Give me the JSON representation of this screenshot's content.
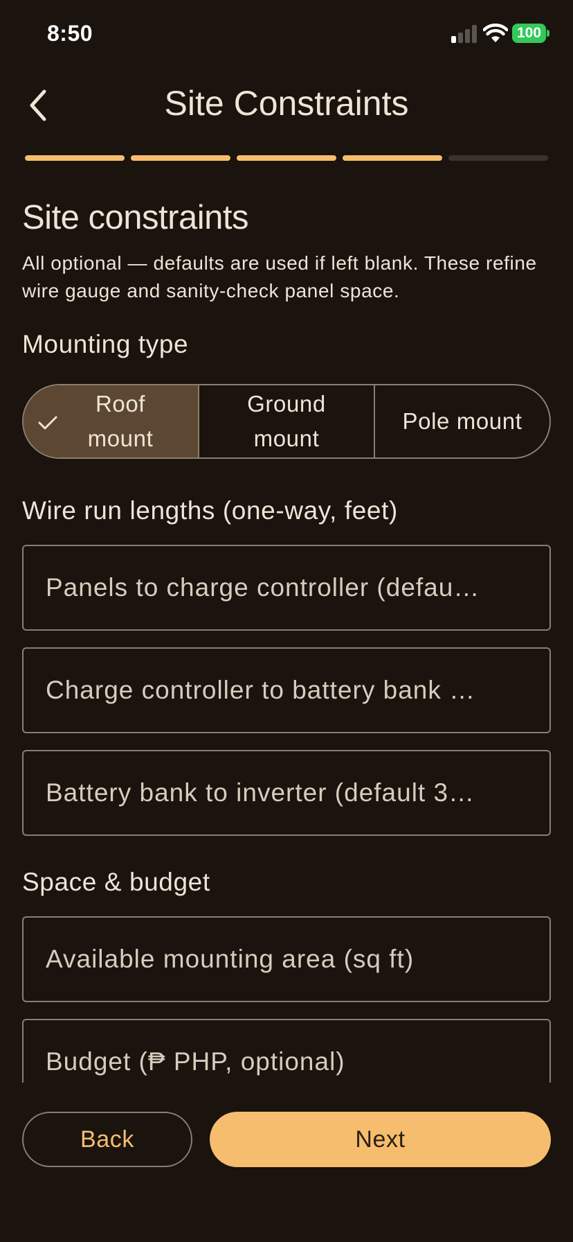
{
  "status_bar": {
    "time": "8:50",
    "battery": "100"
  },
  "header": {
    "title": "Site Constraints",
    "back_icon": "chevron-left-icon"
  },
  "progress": {
    "total_steps": 5,
    "completed_steps": 4
  },
  "intro": {
    "heading": "Site constraints",
    "description": "All optional — defaults are used if left blank. These refine wire gauge and sanity-check panel space."
  },
  "mounting": {
    "title": "Mounting type",
    "options": [
      {
        "label": "Roof\nmount",
        "selected": true
      },
      {
        "label": "Ground\nmount",
        "selected": false
      },
      {
        "label": "Pole mount",
        "selected": false
      }
    ]
  },
  "wire_runs": {
    "title": "Wire run lengths (one-way, feet)",
    "fields": [
      {
        "placeholder": "Panels to charge controller (defau…",
        "value": ""
      },
      {
        "placeholder": "Charge controller to battery bank …",
        "value": ""
      },
      {
        "placeholder": "Battery bank to inverter (default 3…",
        "value": ""
      }
    ]
  },
  "space_budget": {
    "title": "Space & budget",
    "fields": [
      {
        "placeholder": "Available mounting area (sq ft)",
        "value": ""
      },
      {
        "placeholder": "Budget (₱ PHP, optional)",
        "value": ""
      }
    ]
  },
  "footer": {
    "back_label": "Back",
    "next_label": "Next"
  },
  "colors": {
    "background": "#1a130e",
    "accent": "#f6bd6e",
    "selected": "#5c4832",
    "border": "#8a7e6f"
  }
}
